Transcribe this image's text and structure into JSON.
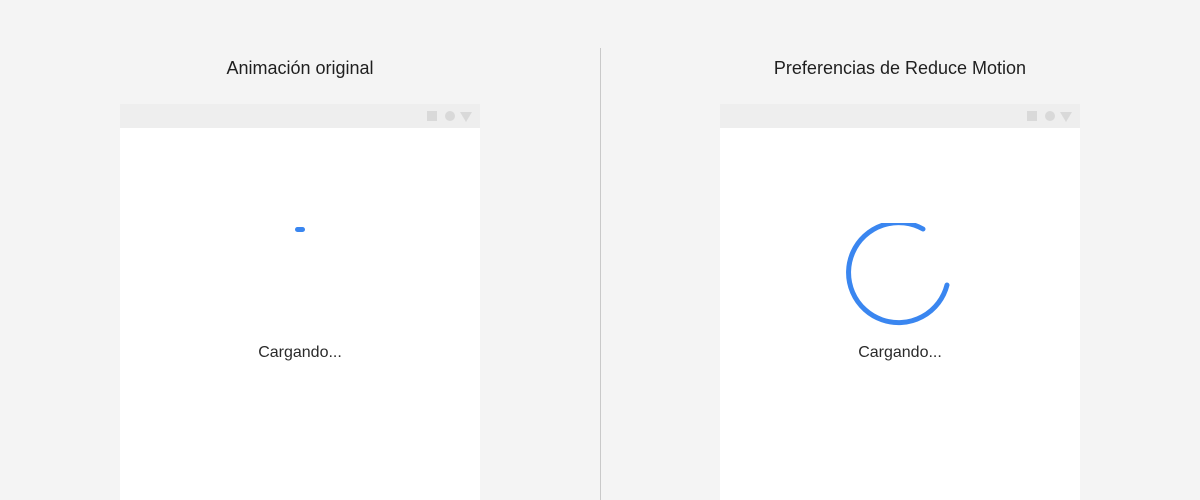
{
  "panels": {
    "left": {
      "title": "Animación original",
      "loading_text": "Cargando..."
    },
    "right": {
      "title": "Preferencias de Reduce Motion",
      "loading_text": "Cargando..."
    }
  },
  "colors": {
    "background": "#f4f4f4",
    "accent": "#3a86f0",
    "window": "#ffffff",
    "titlebar": "#eeeeee",
    "titlebar_controls": "#d9d9d9",
    "divider": "#c9c9c9"
  },
  "icons": {
    "titlebar": [
      "square-icon",
      "circle-icon",
      "triangle-down-icon"
    ],
    "left_loader": "loading-dot-icon",
    "right_loader": "spinner-ring-icon"
  }
}
